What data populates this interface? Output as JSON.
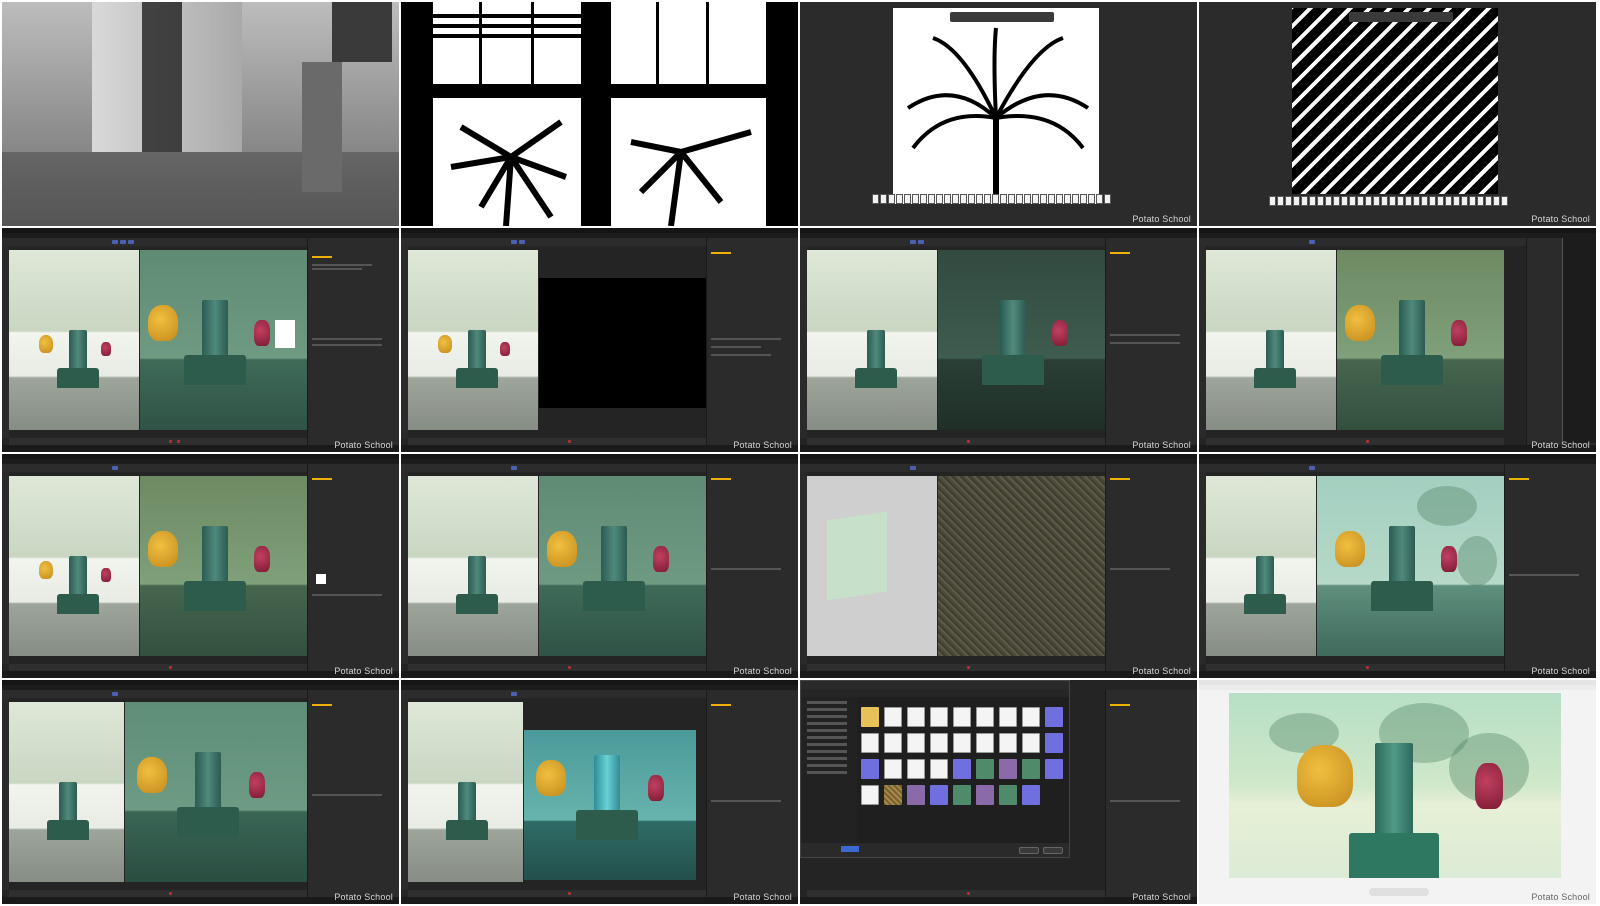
{
  "watermark": "Potato School",
  "frames": [
    {
      "id": 1,
      "kind": "reference-photo",
      "caption": ""
    },
    {
      "id": 2,
      "kind": "gobo-window",
      "caption": ""
    },
    {
      "id": 3,
      "kind": "photoshop-palm",
      "caption": ""
    },
    {
      "id": 4,
      "kind": "photoshop-diagonal",
      "caption": ""
    },
    {
      "id": 5,
      "kind": "c4d-render-white-window",
      "caption": ""
    },
    {
      "id": 6,
      "kind": "c4d-render-black",
      "caption": ""
    },
    {
      "id": 7,
      "kind": "c4d-render-shaded",
      "caption": ""
    },
    {
      "id": 8,
      "kind": "c4d-render-menu",
      "caption": ""
    },
    {
      "id": 9,
      "kind": "c4d-render-warm",
      "caption": ""
    },
    {
      "id": 10,
      "kind": "c4d-render-cyan-shadow",
      "caption": ""
    },
    {
      "id": 11,
      "kind": "c4d-perspective-noise",
      "caption": ""
    },
    {
      "id": 12,
      "kind": "c4d-render-leaf-shadow",
      "caption": ""
    },
    {
      "id": 13,
      "kind": "c4d-render-gobo",
      "caption": ""
    },
    {
      "id": 14,
      "kind": "c4d-render-cyan-gobo",
      "caption": ""
    },
    {
      "id": 15,
      "kind": "file-explorer-open",
      "caption": ""
    },
    {
      "id": 16,
      "kind": "final-image-viewer",
      "caption": ""
    }
  ],
  "colors": {
    "accent_blue": "#4d5fb3",
    "timeline_red": "#c03030",
    "panel_accent": "#f0b000",
    "folder_yellow": "#e8c158"
  }
}
